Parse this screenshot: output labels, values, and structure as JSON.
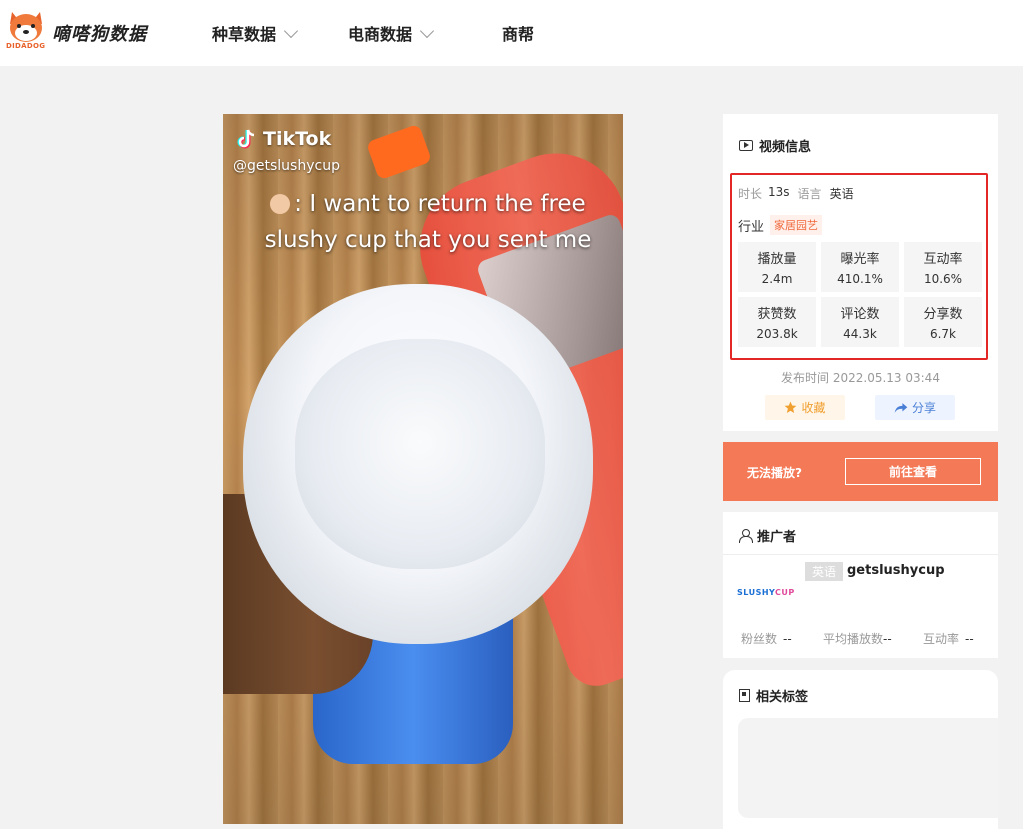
{
  "header": {
    "logo_text": "嘀嗒狗数据",
    "logo_sub": "DIDADOG",
    "nav": [
      {
        "label": "种草数据",
        "dropdown": true
      },
      {
        "label": "电商数据",
        "dropdown": true
      },
      {
        "label": "商帮",
        "dropdown": false
      }
    ]
  },
  "video": {
    "platform": "TikTok",
    "handle": "@getslushycup",
    "caption": ": I want to return the free slushy cup that you sent me"
  },
  "video_info": {
    "title": "视频信息",
    "duration_label": "时长",
    "duration": "13s",
    "language_label": "语言",
    "language": "英语",
    "industry_label": "行业",
    "industry": "家居园艺",
    "stats": [
      {
        "label": "播放量",
        "value": "2.4m"
      },
      {
        "label": "曝光率",
        "value": "410.1%"
      },
      {
        "label": "互动率",
        "value": "10.6%"
      },
      {
        "label": "获赞数",
        "value": "203.8k"
      },
      {
        "label": "评论数",
        "value": "44.3k"
      },
      {
        "label": "分享数",
        "value": "6.7k"
      }
    ],
    "publish_time": "发布时间 2022.05.13 03:44",
    "favorite_label": "收藏",
    "share_label": "分享"
  },
  "cta": {
    "text": "无法播放?",
    "button": "前往查看"
  },
  "promoter": {
    "title": "推广者",
    "language_tag": "英语",
    "name": "getslushycup",
    "logo_main": "SLUSHY",
    "logo_accent": "CUP",
    "fans_label": "粉丝数",
    "fans_value": "--",
    "avg_play_label": "平均播放数",
    "avg_play_value": "--",
    "engagement_label": "互动率",
    "engagement_value": "--"
  },
  "tags": {
    "title": "相关标签"
  },
  "colors": {
    "accent_orange": "#f47a57",
    "highlight_red": "#e32626",
    "tag_orange": "#f0673a"
  }
}
